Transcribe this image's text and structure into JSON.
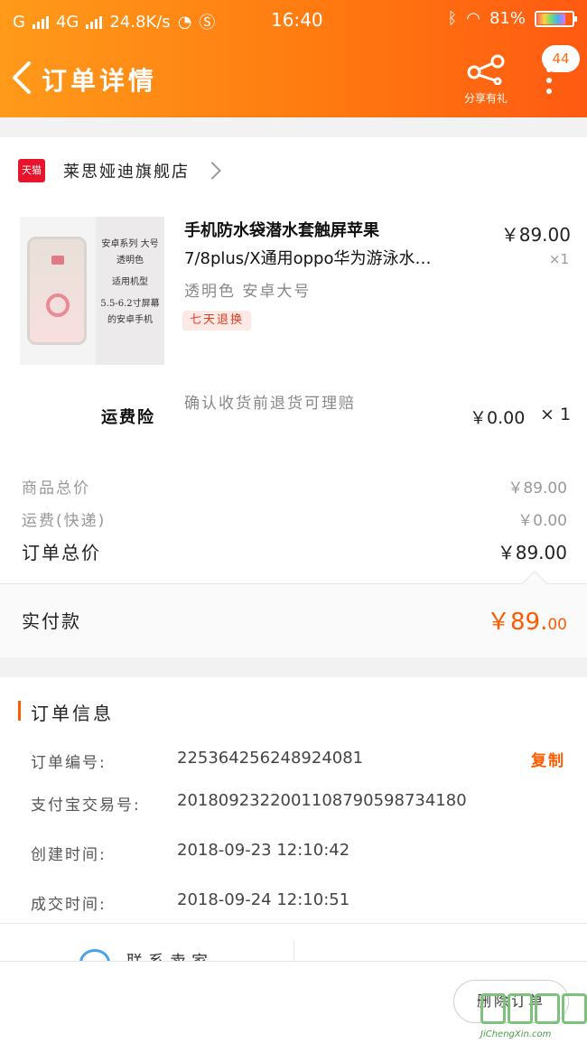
{
  "status_bar": {
    "carrier1": "G",
    "carrier2": "4G",
    "speed": "24.8K/s",
    "time": "16:40",
    "battery": "81%"
  },
  "header": {
    "title": "订单详情",
    "share_label": "分享有礼",
    "badge_count": "44"
  },
  "store": {
    "logo_text": "天猫",
    "name": "莱思娅迪旗舰店"
  },
  "product": {
    "title_line1": "手机防水袋潜水套触屏苹果",
    "title_line2": "7/8plus/X通用oppo华为游泳水…",
    "price": "￥89.00",
    "qty": "×1",
    "spec": "透明色 安卓大号",
    "tag": "七天退换",
    "image_text": [
      "安卓系列 大号",
      "透明色",
      "适用机型",
      "5.5-6.2寸屏幕",
      "的安卓手机"
    ]
  },
  "insurance": {
    "name": "运费险",
    "desc": "确认收货前退货可理赔",
    "price": "￥0.00",
    "qty": "× 1"
  },
  "summary": {
    "goods_label": "商品总价",
    "goods_value": "￥89.00",
    "shipping_label": "运费(快递)",
    "shipping_value": "￥0.00",
    "total_label": "订单总价",
    "total_value": "￥89.00",
    "paid_label": "实付款",
    "paid_main": "￥89.",
    "paid_cents": "00"
  },
  "order_info": {
    "title": "订单信息",
    "rows": [
      {
        "label": "订单编号:",
        "value": "225364256248924081"
      },
      {
        "label": "支付宝交易号:",
        "value": "2018092322001108790598734180"
      },
      {
        "label": "创建时间:",
        "value": "2018-09-23 12:10:42"
      },
      {
        "label": "成交时间:",
        "value": "2018-09-24 12:10:51"
      }
    ],
    "copy_label": "复制"
  },
  "lower": {
    "contact_label": "联系卖家"
  },
  "bottom": {
    "delete_label": "删除订单"
  },
  "watermark": {
    "url": "JiChengXin.com"
  },
  "colors": {
    "header_start": "#ff9a1a",
    "header_end": "#ff5a12",
    "accent": "#ff5a00"
  }
}
